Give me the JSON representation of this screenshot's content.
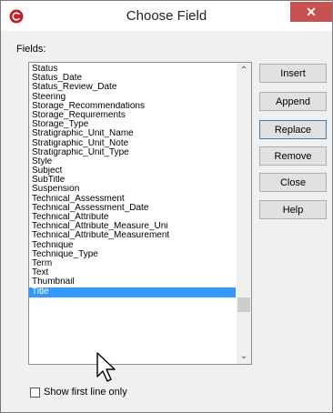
{
  "window": {
    "title": "Choose Field",
    "close_glyph": "✕",
    "icon": "app-logo-icon"
  },
  "fields_label": "Fields:",
  "fields": [
    "Status",
    "Status_Date",
    "Status_Review_Date",
    "Steering",
    "Storage_Recommendations",
    "Storage_Requirements",
    "Storage_Type",
    "Stratigraphic_Unit_Name",
    "Stratigraphic_Unit_Note",
    "Stratigraphic_Unit_Type",
    "Style",
    "Subject",
    "SubTitle",
    "Suspension",
    "Technical_Assessment",
    "Technical_Assessment_Date",
    "Technical_Attribute",
    "Technical_Attribute_Measure_Uni",
    "Technical_Attribute_Measurement",
    "Technique",
    "Technique_Type",
    "Term",
    "Text",
    "Thumbnail",
    "Title"
  ],
  "selected_field": "Title",
  "scrollbar": {
    "up_glyph": "⌃",
    "down_glyph": "⌄"
  },
  "buttons": {
    "insert": "Insert",
    "append": "Append",
    "replace": "Replace",
    "remove": "Remove",
    "close": "Close",
    "help": "Help"
  },
  "show_first_line_only": {
    "label": "Show first line only",
    "checked": false
  },
  "colors": {
    "selection": "#3399ff",
    "close_button": "#c75050",
    "default_button_border": "#3c7fb1"
  }
}
